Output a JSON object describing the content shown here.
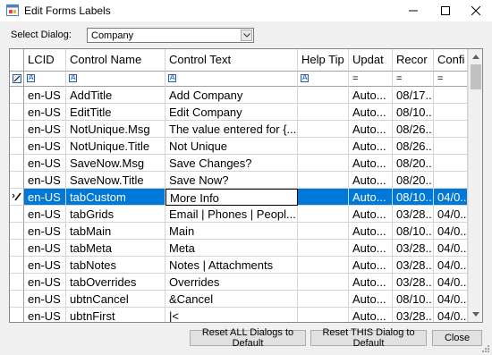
{
  "window": {
    "title": "Edit Forms Labels",
    "icons": [
      "app-icon",
      "minimize-icon",
      "maximize-icon",
      "close-icon"
    ]
  },
  "dialog_select": {
    "label": "Select Dialog:",
    "value": "Company"
  },
  "grid": {
    "columns": [
      "LCID",
      "Control Name",
      "Control Text",
      "Help Tip",
      "Updat",
      "Recor",
      "Confi"
    ],
    "filter_row": [
      "icon",
      "icon",
      "icon",
      "icon",
      "=",
      "=",
      "="
    ],
    "rows": [
      [
        "en-US",
        "AddTitle",
        "Add Company",
        "",
        "Auto...",
        "08/17...",
        ""
      ],
      [
        "en-US",
        "EditTitle",
        "Edit Company",
        "",
        "Auto...",
        "08/10...",
        ""
      ],
      [
        "en-US",
        "NotUnique.Msg",
        "The value entered for {...",
        "",
        "Auto...",
        "08/26...",
        ""
      ],
      [
        "en-US",
        "NotUnique.Title",
        "Not Unique",
        "",
        "Auto...",
        "08/26...",
        ""
      ],
      [
        "en-US",
        "SaveNow.Msg",
        "Save Changes?",
        "",
        "Auto...",
        "08/20...",
        ""
      ],
      [
        "en-US",
        "SaveNow.Title",
        "Save Now?",
        "",
        "Auto...",
        "08/20...",
        ""
      ],
      [
        "en-US",
        "tabCustom",
        "More Info",
        "",
        "Auto...",
        "08/10...",
        "04/0..."
      ],
      [
        "en-US",
        "tabGrids",
        "Email | Phones | Peopl...",
        "",
        "Auto...",
        "03/28...",
        "04/0..."
      ],
      [
        "en-US",
        "tabMain",
        "Main",
        "",
        "Auto...",
        "08/10...",
        "04/0..."
      ],
      [
        "en-US",
        "tabMeta",
        "Meta",
        "",
        "Auto...",
        "03/28...",
        "04/0..."
      ],
      [
        "en-US",
        "tabNotes",
        "Notes | Attachments",
        "",
        "Auto...",
        "03/28...",
        "04/0..."
      ],
      [
        "en-US",
        "tabOverrides",
        "Overrides",
        "",
        "Auto...",
        "03/28...",
        "04/0..."
      ],
      [
        "en-US",
        "ubtnCancel",
        "&Cancel",
        "",
        "Auto...",
        "08/10...",
        "04/0..."
      ],
      [
        "en-US",
        "ubtnFirst",
        "|<",
        "",
        "Auto...",
        "03/28...",
        "04/0..."
      ]
    ],
    "selected_row": 6,
    "selection_color": "#0078d7"
  },
  "buttons": {
    "reset_all": "Reset ALL Dialogs to Default",
    "reset_this": "Reset THIS Dialog to Default",
    "close": "Close"
  }
}
